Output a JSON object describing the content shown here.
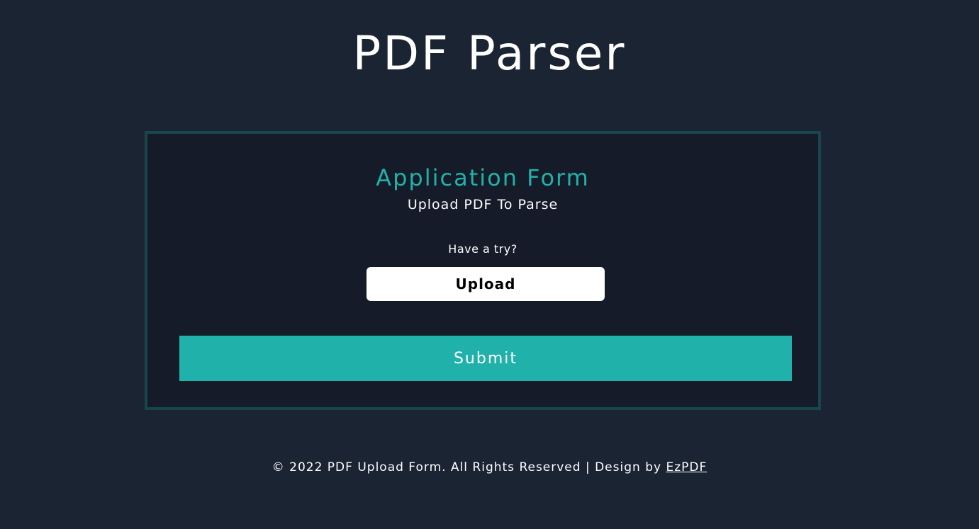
{
  "page": {
    "title": "PDF Parser"
  },
  "form": {
    "heading": "Application Form",
    "subtitle": "Upload PDF To Parse",
    "upload_prompt": "Have a try?",
    "upload_label": "Upload",
    "submit_label": "Submit"
  },
  "footer": {
    "text": "© 2022 PDF Upload Form. All Rights Reserved | Design by",
    "link_label": "EzPDF"
  },
  "colors": {
    "background": "#1b2433",
    "card_background": "#151b28",
    "card_border": "#17464d",
    "accent": "#20b2aa",
    "upload_button": "#ffffff"
  }
}
